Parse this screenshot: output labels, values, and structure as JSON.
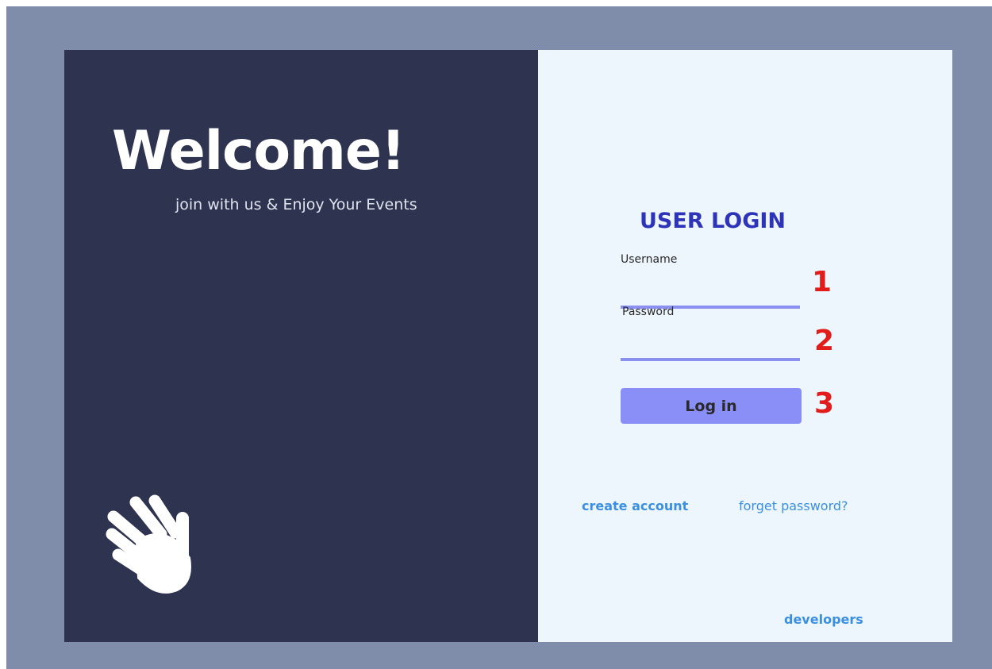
{
  "left": {
    "welcome": "Welcome!",
    "tagline": "join with us & Enjoy Your Events",
    "icon": "waving-hand-icon"
  },
  "login": {
    "title": "USER LOGIN",
    "username_label": "Username",
    "username_value": "",
    "password_label": "Password",
    "password_value": "",
    "button_label": "Log in"
  },
  "annotations": [
    "1",
    "2",
    "3"
  ],
  "links": {
    "create_account": "create account",
    "forget_password": "forget password?",
    "developers": "developers"
  },
  "colors": {
    "outer_background": "#7f8dab",
    "left_panel": "#2e3450",
    "right_panel": "#eef6fd",
    "accent": "#8a8ff7",
    "title": "#2e34b8",
    "link": "#3a8fe0",
    "annotation": "#e21b1b"
  }
}
